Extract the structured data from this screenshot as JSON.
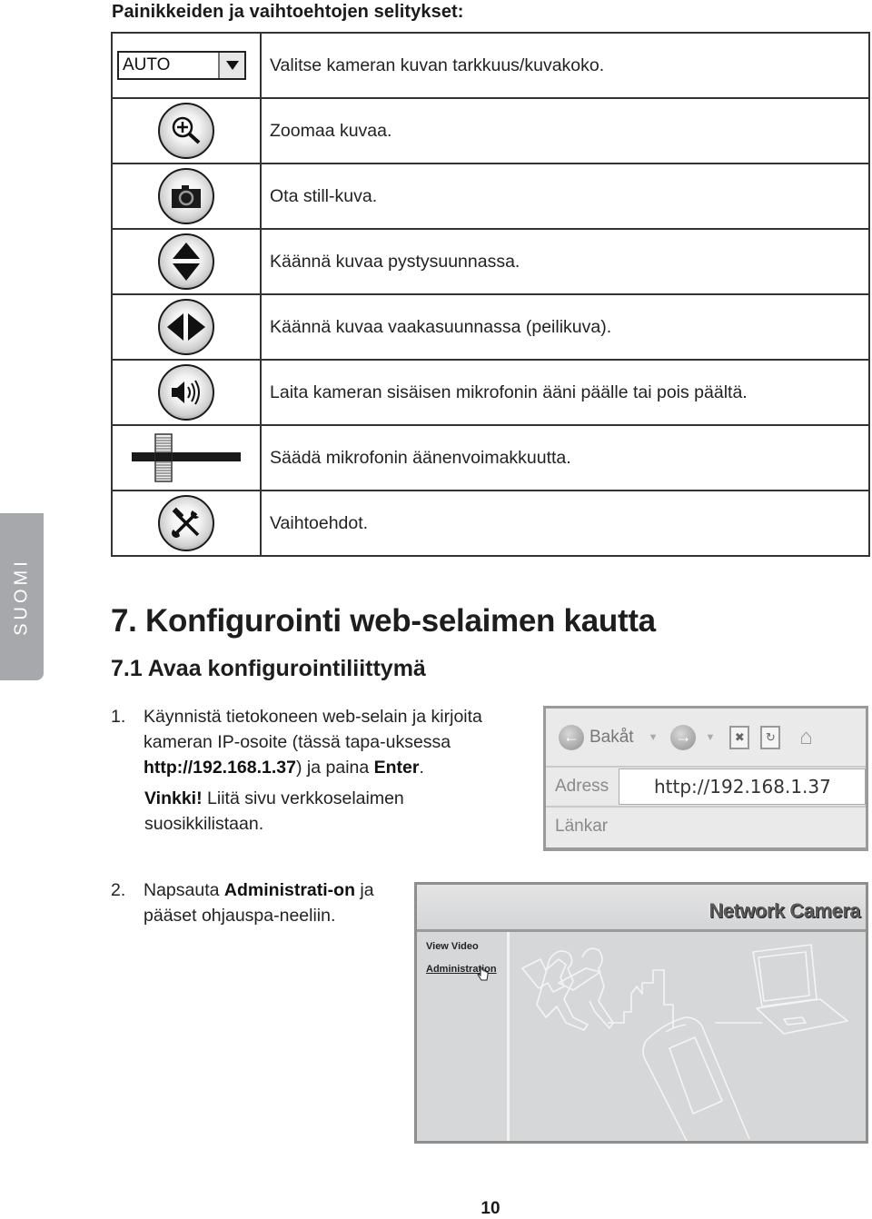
{
  "legend": {
    "title": "Painikkeiden ja vaihtoehtojen selitykset:",
    "rows": [
      {
        "icon": "resolution-select",
        "select_value": "AUTO",
        "description": "Valitse kameran kuvan tarkkuus/kuvakoko."
      },
      {
        "icon": "zoom-in-icon",
        "description": "Zoomaa kuvaa."
      },
      {
        "icon": "camera-icon",
        "description": "Ota still-kuva."
      },
      {
        "icon": "flip-vertical-icon",
        "description": "Käännä kuvaa pystysuunnassa."
      },
      {
        "icon": "flip-horizontal-icon",
        "description": "Käännä kuvaa vaakasuunnassa (peilikuva)."
      },
      {
        "icon": "speaker-icon",
        "description": "Laita kameran sisäisen mikrofonin ääni päälle tai pois päältä."
      },
      {
        "icon": "volume-slider-icon",
        "description": "Säädä mikrofonin äänenvoimakkuutta."
      },
      {
        "icon": "tools-icon",
        "description": "Vaihtoehdot."
      }
    ]
  },
  "side_tab": {
    "label": "SUOMI",
    "color": "#a7a8ab"
  },
  "section": {
    "heading": "7. Konfigurointi web-selaimen kautta",
    "subheading": "7.1 Avaa konfigurointiliittymä"
  },
  "steps": {
    "step1": {
      "number": "1.",
      "text_a": "Käynnistä tietokoneen web-selain ja kirjoita kameran IP-osoite (tässä tapa-uksessa ",
      "url": "http://192.168.1.37",
      "text_b": ") ja paina ",
      "enter": "Enter",
      "text_c": ".",
      "tip_label": "Vinkki!",
      "tip_text": " Liitä sivu verkkoselaimen suosikkilistaan."
    },
    "step2": {
      "number": "2.",
      "text_a": "Napsauta ",
      "admin": "Administrati-on",
      "text_b": " ja pääset ohjauspa-neeliin."
    }
  },
  "browser_screenshot": {
    "back_label": "Bakåt",
    "address_label": "Adress",
    "address_value": "http://192.168.1.37",
    "links_label": "Länkar"
  },
  "netcam_screenshot": {
    "title": "Network Camera",
    "nav": [
      "View Video",
      "Administration"
    ]
  },
  "page_number": "10"
}
